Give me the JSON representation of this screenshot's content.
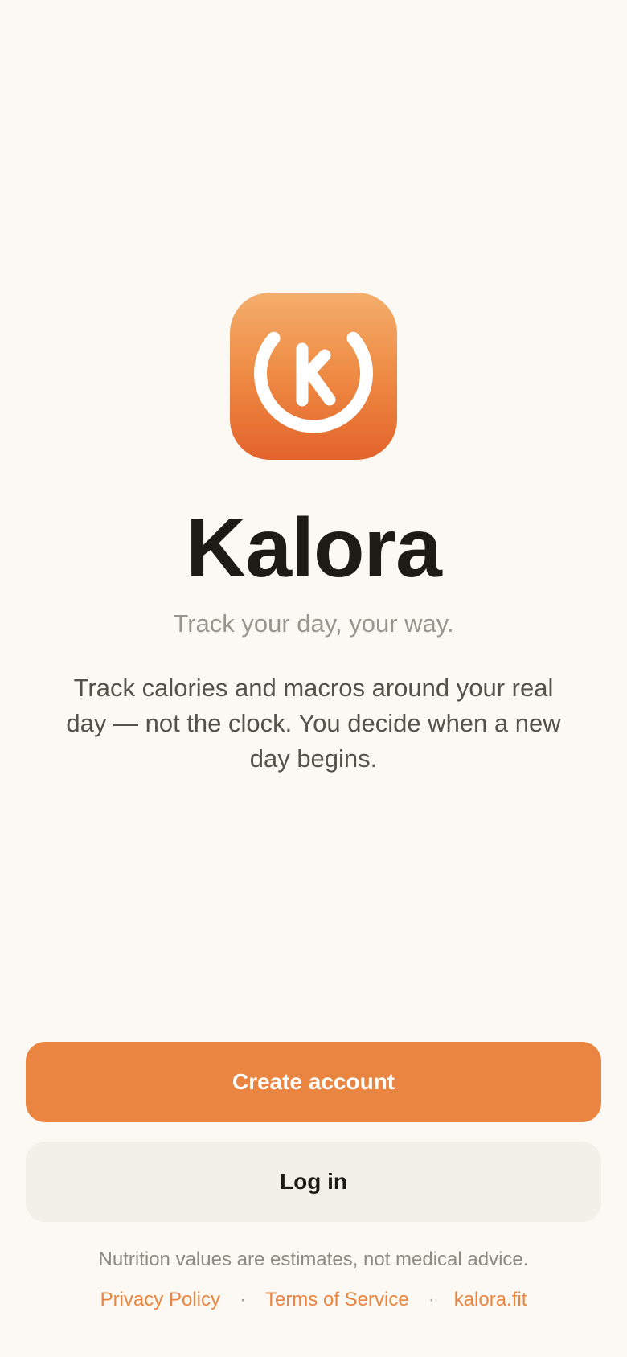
{
  "app": {
    "title": "Kalora",
    "tagline": "Track your day, your way.",
    "description": "Track calories and macros around your real day — not the clock. You decide when a new day begins.",
    "icon": "kalora-logo-icon",
    "brand_color": "#E98540"
  },
  "actions": {
    "create_account_label": "Create account",
    "log_in_label": "Log in"
  },
  "footer": {
    "disclaimer": "Nutrition values are estimates, not medical advice.",
    "links": [
      {
        "label": "Privacy Policy"
      },
      {
        "label": "Terms of Service"
      },
      {
        "label": "kalora.fit"
      }
    ],
    "separator": "·"
  }
}
